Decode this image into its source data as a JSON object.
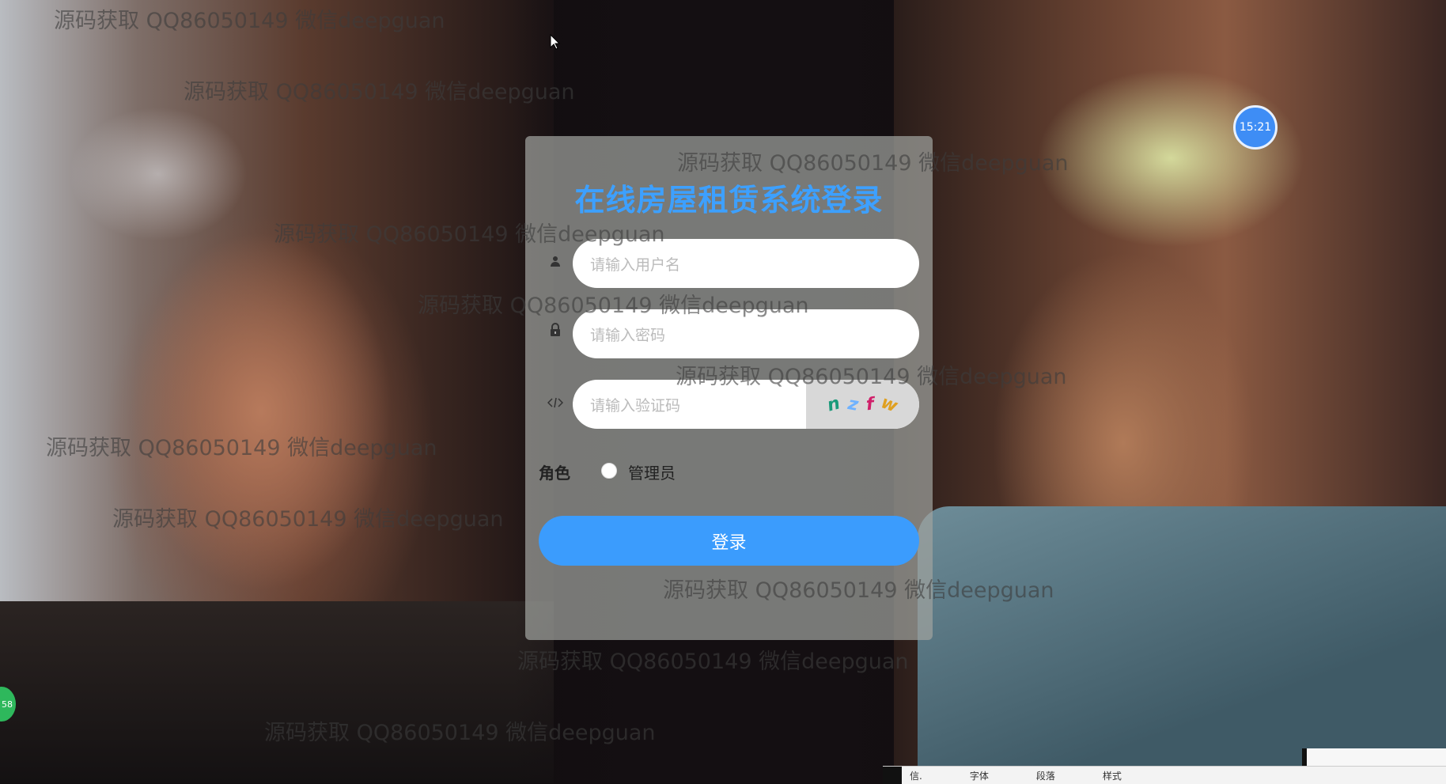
{
  "login": {
    "title": "在线房屋租赁系统登录",
    "username_placeholder": "请输入用户名",
    "password_placeholder": "请输入密码",
    "captcha_placeholder": "请输入验证码",
    "captcha_chars": [
      {
        "char": "n",
        "color": "#1a9a7a"
      },
      {
        "char": "z",
        "color": "#6fb2ff"
      },
      {
        "char": "f",
        "color": "#d0206a"
      },
      {
        "char": "w",
        "color": "#e0a020"
      }
    ],
    "role_label": "角色",
    "role_option": "管理员",
    "login_button": "登录"
  },
  "watermark_text": "源码获取 QQ86050149 微信deepguan",
  "clock": "15:21",
  "left_badge": "58",
  "bottom_strip": [
    "信.",
    "字体",
    "段落",
    "样式"
  ],
  "colors": {
    "accent": "#3b9cfd",
    "title": "#3da0ff"
  }
}
